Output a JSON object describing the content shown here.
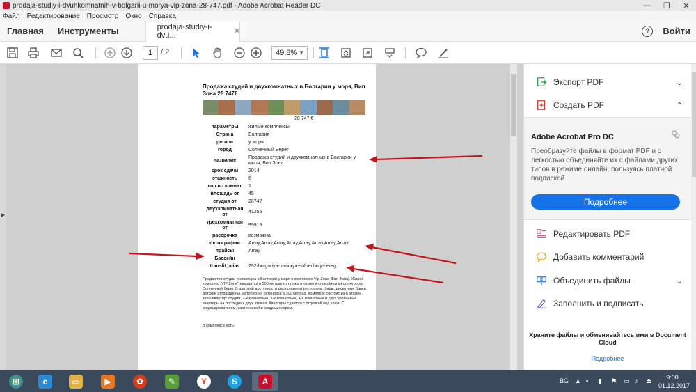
{
  "window": {
    "title": "prodaja-studiy-i-dvuhkomnatnih-v-bolgarii-u-morya-vip-zona-28-747.pdf - Adobe Acrobat Reader DC",
    "minimize": "—",
    "maximize": "❐",
    "close": "✕"
  },
  "menu": [
    "Файл",
    "Редактирование",
    "Просмотр",
    "Окно",
    "Справка"
  ],
  "tabs": {
    "home": "Главная",
    "tools": "Инструменты",
    "document": "prodaja-studiy-i-dvu...",
    "close": "×",
    "help": "?",
    "login": "Войти"
  },
  "toolbar": {
    "page_current": "1",
    "page_total": "/ 2",
    "zoom": "49,8%"
  },
  "document": {
    "title": "Продажа студий и двухкомнатных в Болгарии у моря, Вип Зона 28 747€",
    "price": "28 747 €",
    "photo_colors": [
      "#7a8a6a",
      "#a86e4c",
      "#8fa7c0",
      "#b17a55",
      "#6f8f5a",
      "#c09b6b",
      "#7da1c4",
      "#9a6b4a",
      "#6b8b9e",
      "#b58b63"
    ],
    "rows": [
      {
        "key": "параметры",
        "value": "жилые комплексы"
      },
      {
        "key": "Страна",
        "value": "Болгария"
      },
      {
        "key": "регион",
        "value": "у моря"
      },
      {
        "key": "город",
        "value": "Солнечный Берег"
      },
      {
        "key": "название",
        "value": "Продажа студий и двухкомнатных в Болгарии у моря, Вип Зона"
      },
      {
        "key": "срок сдачи",
        "value": "2014"
      },
      {
        "key": "этажность",
        "value": "6"
      },
      {
        "key": "кол.во комнат",
        "value": "1"
      },
      {
        "key": "площадь от",
        "value": "45"
      },
      {
        "key": "студия от",
        "value": "28747"
      },
      {
        "key": "двухкомнатная от",
        "value": "41255"
      },
      {
        "key": "трехкомнатная от",
        "value": "99918"
      },
      {
        "key": "рассрочка",
        "value": "возможна"
      },
      {
        "key": "фотографии",
        "value": "Array,Array,Array,Array,Array,Array,Array,Array"
      },
      {
        "key": "прайсы",
        "value": "Array"
      },
      {
        "key": "Бассейн",
        "value": ""
      },
      {
        "key": "translit_alias",
        "value": "292-bolgariya-u-morya-solnechniy-bereg"
      }
    ],
    "description": "Продаются студии и квартиры в Болгарии у моря в комплексе Vip Zone (Вип Зона). Жилой комплекс „VIP Zone\" находится в 500 метрах от пляжа в тихом и спокойном месте курорта Солнечный берег. В шаговой доступности расположены рестораны, бары, дискотеки, банки, детские аттракционы, автобусная остановка в 300 метрах. Комплекс состоит из 6 этажей, типы квартир: студии, 2-х комнатные, 3-х комнатные, 4-х комнатные и двух уровневые квартиры на последних двух этажах. Квартиры сдаются с отделкой под ключ. С водонагревателем, сантехникой и кондиционером.",
    "footer": "В комплексе есть:"
  },
  "panel": {
    "export_pdf": "Экспорт PDF",
    "create_pdf": "Создать PDF",
    "promo_title": "Adobe Acrobat Pro DC",
    "promo_text": "Преобразуйте файлы в формат PDF и с легкостью объединяйте их с файлами других типов в режиме онлайн, пользуясь платной подпиской",
    "promo_button": "Подробнее",
    "edit_pdf": "Редактировать PDF",
    "add_comment": "Добавить комментарий",
    "combine_files": "Объединить файлы",
    "fill_sign": "Заполнить и подписать",
    "share_text": "Храните файлы и обменивайтесь ими в Document Cloud",
    "share_link": "Подробнее"
  },
  "taskbar": {
    "lang": "BG",
    "time": "9:00",
    "date": "01.12.2017"
  },
  "colors": {
    "accent": "#1473e6",
    "arrow": "#c0161c",
    "taskbar": "#3a4a5c"
  }
}
